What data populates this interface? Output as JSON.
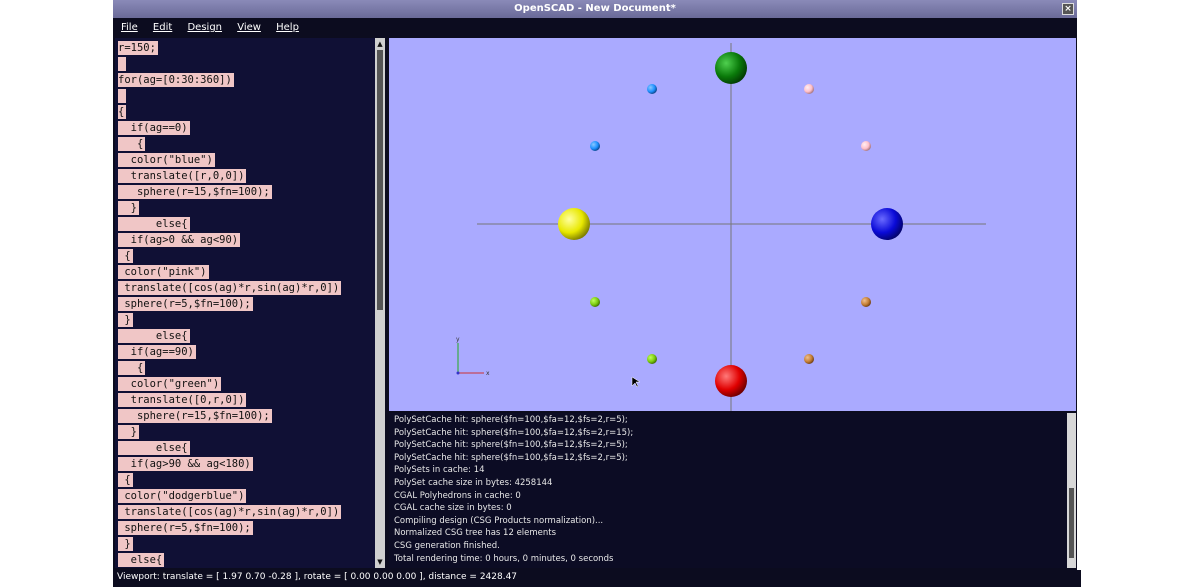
{
  "window": {
    "title": "OpenSCAD - New Document*"
  },
  "menu": [
    "File",
    "Edit",
    "Design",
    "View",
    "Help"
  ],
  "editor_lines": [
    "r=150;",
    "",
    "for(ag=[0:30:360])",
    "",
    "{",
    "  if(ag==0)",
    "   {",
    "  color(\"blue\")",
    "  translate([r,0,0])",
    "   sphere(r=15,$fn=100);",
    "  }",
    "      else{",
    "  if(ag>0 && ag<90)",
    " {",
    " color(\"pink\")",
    " translate([cos(ag)*r,sin(ag)*r,0])",
    " sphere(r=5,$fn=100);",
    " }",
    "      else{",
    "  if(ag==90)",
    "   {",
    "  color(\"green\")",
    "  translate([0,r,0])",
    "   sphere(r=15,$fn=100);",
    "  }",
    "      else{",
    "  if(ag>90 && ag<180)",
    " {",
    " color(\"dodgerblue\")",
    " translate([cos(ag)*r,sin(ag)*r,0])",
    " sphere(r=5,$fn=100);",
    " }",
    "  else{"
  ],
  "console_lines": [
    "PolySetCache hit: sphere($fn=100,$fa=12,$fs=2,r=5);",
    "PolySetCache hit: sphere($fn=100,$fa=12,$fs=2,r=15);",
    "PolySetCache hit: sphere($fn=100,$fa=12,$fs=2,r=5);",
    "PolySetCache hit: sphere($fn=100,$fa=12,$fs=2,r=5);",
    "PolySets in cache: 14",
    "PolySet cache size in bytes: 4258144",
    "CGAL Polyhedrons in cache: 0",
    "CGAL cache size in bytes: 0",
    "Compiling design (CSG Products normalization)...",
    "Normalized CSG tree has 12 elements",
    "CSG generation finished.",
    "Total rendering time: 0 hours, 0 minutes, 0 seconds"
  ],
  "status": "Viewport: translate = [ 1.97 0.70 -0.28 ], rotate = [ 0.00 0.00 0.00 ], distance = 2428.47",
  "viewport_colors": {
    "background": "#aaaaff",
    "axis": "#777777"
  },
  "spheres": [
    {
      "name": "sphere-green",
      "color": "#0a7a0a",
      "size": "large"
    },
    {
      "name": "sphere-blue",
      "color": "#0a0ad8",
      "size": "large"
    },
    {
      "name": "sphere-red",
      "color": "#e00000",
      "size": "large"
    },
    {
      "name": "sphere-yellow",
      "color": "#e8e800",
      "size": "large"
    },
    {
      "name": "sphere-pink",
      "color": "#ffc0cb",
      "size": "small"
    },
    {
      "name": "sphere-dodgerblue",
      "color": "#1e90ff",
      "size": "small"
    },
    {
      "name": "sphere-yellowgreen",
      "color": "#7ccc10",
      "size": "small"
    },
    {
      "name": "sphere-peru",
      "color": "#c57f35",
      "size": "small"
    }
  ]
}
